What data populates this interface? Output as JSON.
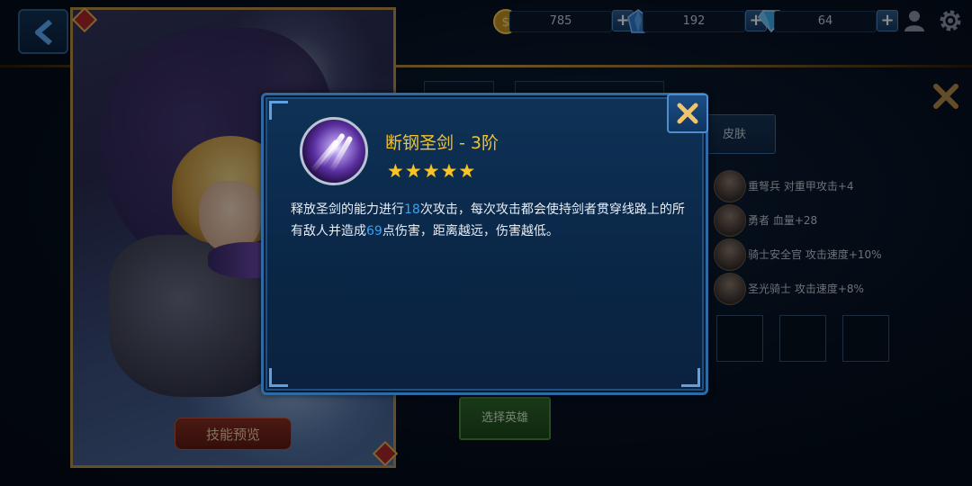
{
  "resources": {
    "gold": {
      "value": "785",
      "icon": "gold-coin-icon",
      "add": "+"
    },
    "crystal": {
      "value": "192",
      "icon": "blue-crystal-icon",
      "add": "+"
    },
    "diamond": {
      "value": "64",
      "icon": "diamond-icon",
      "add": "+"
    }
  },
  "hero_card": {
    "skill_preview_label": "技能预览"
  },
  "right_panel": {
    "skin_tab_label": "皮肤",
    "bonds": [
      {
        "text": "重弩兵 对重甲攻击+4"
      },
      {
        "text": "勇者 血量+28"
      },
      {
        "text": "骑士安全官 攻击速度+10%"
      },
      {
        "text": "圣光骑士 攻击速度+8%"
      }
    ],
    "select_hero_label": "选择英雄"
  },
  "skill_dialog": {
    "title": "断钢圣剑 - 3阶",
    "stars": 5,
    "desc_1": "释放圣剑的能力进行",
    "desc_hits": "18",
    "desc_2": "次攻击，每次攻击都会使持剑者贯穿线路上的所有敌人并造成",
    "desc_damage": "69",
    "desc_3": "点伤害，距离越远，伤害越低。"
  },
  "colors": {
    "title_gold": "#f2c230",
    "highlight_blue": "#3aa0f0",
    "dialog_border": "#2e6aa4"
  }
}
